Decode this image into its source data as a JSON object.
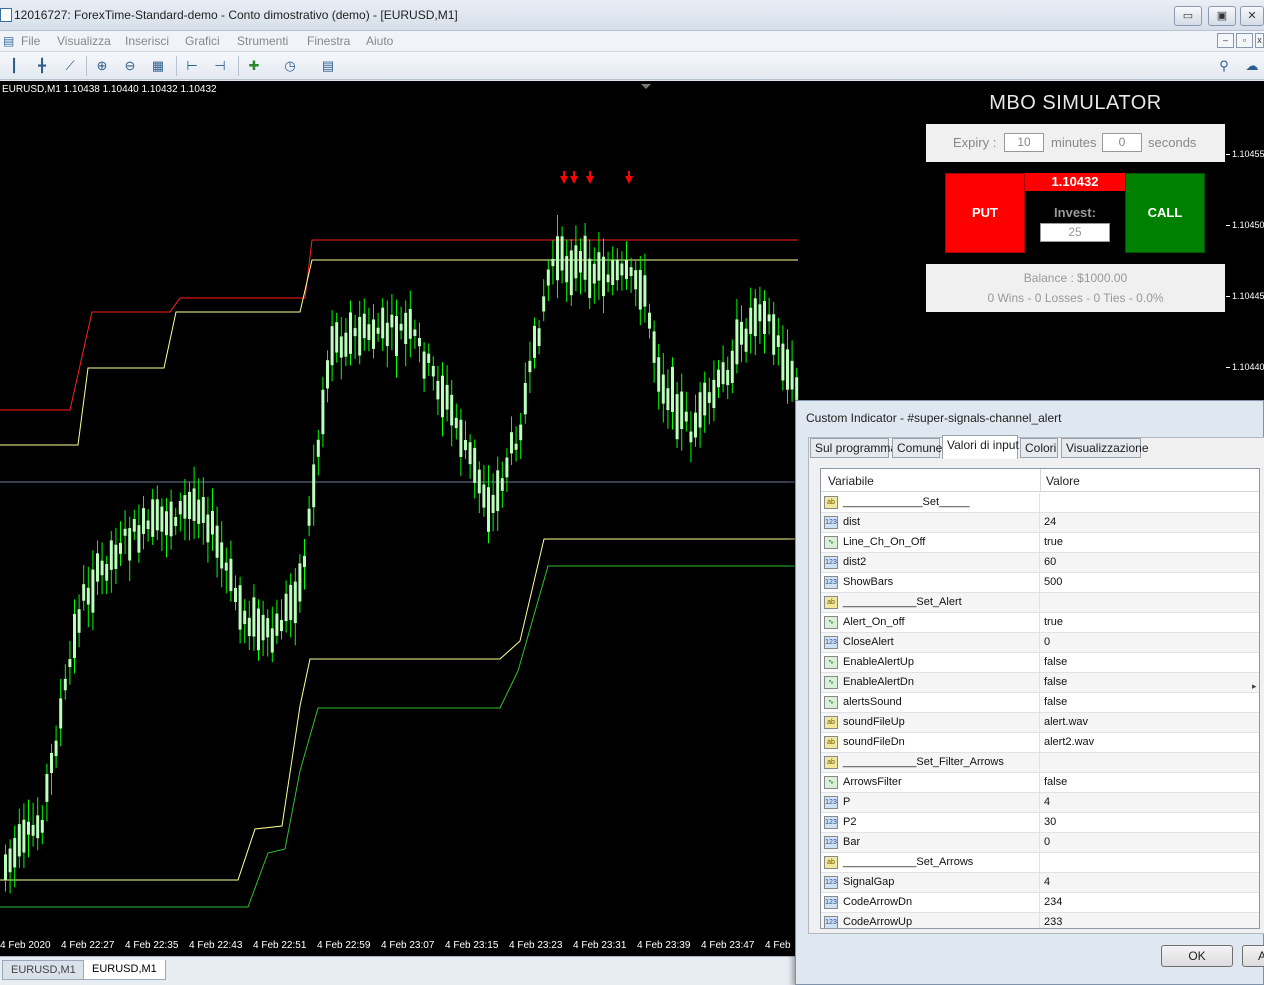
{
  "window": {
    "title": "12016727: ForexTime-Standard-demo - Conto dimostrativo (demo) - [EURUSD,M1]",
    "minimize": "▭",
    "restore": "▣",
    "close": "✕"
  },
  "menu": {
    "items": [
      "File",
      "Visualizza",
      "Inserisci",
      "Grafici",
      "Strumenti",
      "Finestra",
      "Aiuto"
    ]
  },
  "chart": {
    "symbol_line": "EURUSD,M1  1.10438 1.10440 1.10432 1.10432",
    "price_labels": [
      "1.10455",
      "1.10450",
      "1.10445",
      "1.10440"
    ],
    "time_labels": [
      "4 Feb 2020",
      "4 Feb 22:27",
      "4 Feb 22:35",
      "4 Feb 22:43",
      "4 Feb 22:51",
      "4 Feb 22:59",
      "4 Feb 23:07",
      "4 Feb 23:15",
      "4 Feb 23:23",
      "4 Feb 23:31",
      "4 Feb 23:39",
      "4 Feb 23:47",
      "4 Feb"
    ],
    "colors": {
      "candle": "#baffba",
      "wick": "#00ff00",
      "upper_red": "#ff2020",
      "upper_yellow": "#ffff99",
      "lower_yellow": "#ffff99",
      "lower_green": "#30c030",
      "signal_arrow": "#ff0000",
      "grid_line": "#7080a0"
    }
  },
  "tabs": [
    "EURUSD,M1",
    "EURUSD,M1"
  ],
  "mbo": {
    "title": "MBO SIMULATOR",
    "expiry_label": "Expiry :",
    "expiry_minutes": "10",
    "minutes_label": "minutes",
    "expiry_seconds": "0",
    "seconds_label": "seconds",
    "put_label": "PUT",
    "call_label": "CALL",
    "current_price": "1.10432",
    "invest_label": "Invest:",
    "invest_value": "25",
    "balance": "Balance : $1000.00",
    "stats": "0 Wins - 0 Losses - 0 Ties - 0.0%",
    "colors": {
      "put": "#ff0000",
      "call": "#008000"
    }
  },
  "dialog": {
    "title": "Custom Indicator - #super-signals-channel_alert",
    "tabs": [
      "Sul programma",
      "Comune",
      "Valori di input",
      "Colori",
      "Visualizzazione"
    ],
    "active_tab": "Valori di input",
    "col_variable": "Variabile",
    "col_value": "Valore",
    "rows": [
      {
        "type": "str",
        "name": "_____________Set_____",
        "value": ""
      },
      {
        "type": "num",
        "name": "dist",
        "value": "24"
      },
      {
        "type": "bool",
        "name": "Line_Ch_On_Off",
        "value": "true"
      },
      {
        "type": "num",
        "name": "dist2",
        "value": "60"
      },
      {
        "type": "num",
        "name": "ShowBars",
        "value": "500"
      },
      {
        "type": "str",
        "name": "____________Set_Alert",
        "value": ""
      },
      {
        "type": "bool",
        "name": "Alert_On_off",
        "value": "true"
      },
      {
        "type": "num",
        "name": "CloseAlert",
        "value": "0"
      },
      {
        "type": "bool",
        "name": "EnableAlertUp",
        "value": "false"
      },
      {
        "type": "bool",
        "name": "EnableAlertDn",
        "value": "false"
      },
      {
        "type": "bool",
        "name": "alertsSound",
        "value": "false"
      },
      {
        "type": "str",
        "name": "soundFileUp",
        "value": "alert.wav"
      },
      {
        "type": "str",
        "name": "soundFileDn",
        "value": "alert2.wav"
      },
      {
        "type": "str",
        "name": "____________Set_Filter_Arrows",
        "value": ""
      },
      {
        "type": "bool",
        "name": "ArrowsFilter",
        "value": "false"
      },
      {
        "type": "num",
        "name": "P",
        "value": "4"
      },
      {
        "type": "num",
        "name": "P2",
        "value": "30"
      },
      {
        "type": "num",
        "name": "Bar",
        "value": "0"
      },
      {
        "type": "str",
        "name": "____________Set_Arrows",
        "value": ""
      },
      {
        "type": "num",
        "name": "SignalGap",
        "value": "4"
      },
      {
        "type": "num",
        "name": "CodeArrowDn",
        "value": "234"
      },
      {
        "type": "num",
        "name": "CodeArrowUp",
        "value": "233"
      }
    ],
    "ok_label": "OK",
    "cancel_label": "A"
  }
}
